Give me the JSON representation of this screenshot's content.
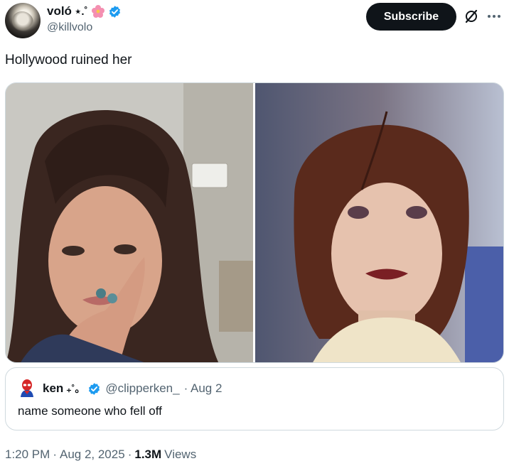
{
  "author": {
    "display_name": "voló",
    "name_suffix": "⋆.˚",
    "flower_icon": "hibiscus-icon",
    "verified_icon": "verified-badge-icon",
    "handle": "@killvolo"
  },
  "actions": {
    "subscribe_label": "Subscribe",
    "grok_icon": "grok-icon",
    "more_icon": "more-icon"
  },
  "tweet": {
    "text": "Hollywood ruined her",
    "media": [
      "left-photo",
      "right-photo"
    ]
  },
  "quote": {
    "display_name": "ken",
    "name_suffix": "₊˚。",
    "handle": "@clipperken_",
    "date": "· Aug 2",
    "text": "name someone who fell off"
  },
  "meta": {
    "time": "1:20 PM",
    "date": "Aug 2, 2025",
    "separator": "·",
    "views_count": "1.3M",
    "views_label": "Views"
  },
  "colors": {
    "text_primary": "#0f1419",
    "text_secondary": "#536471",
    "verified": "#1d9bf0",
    "border": "#cfd9de"
  }
}
